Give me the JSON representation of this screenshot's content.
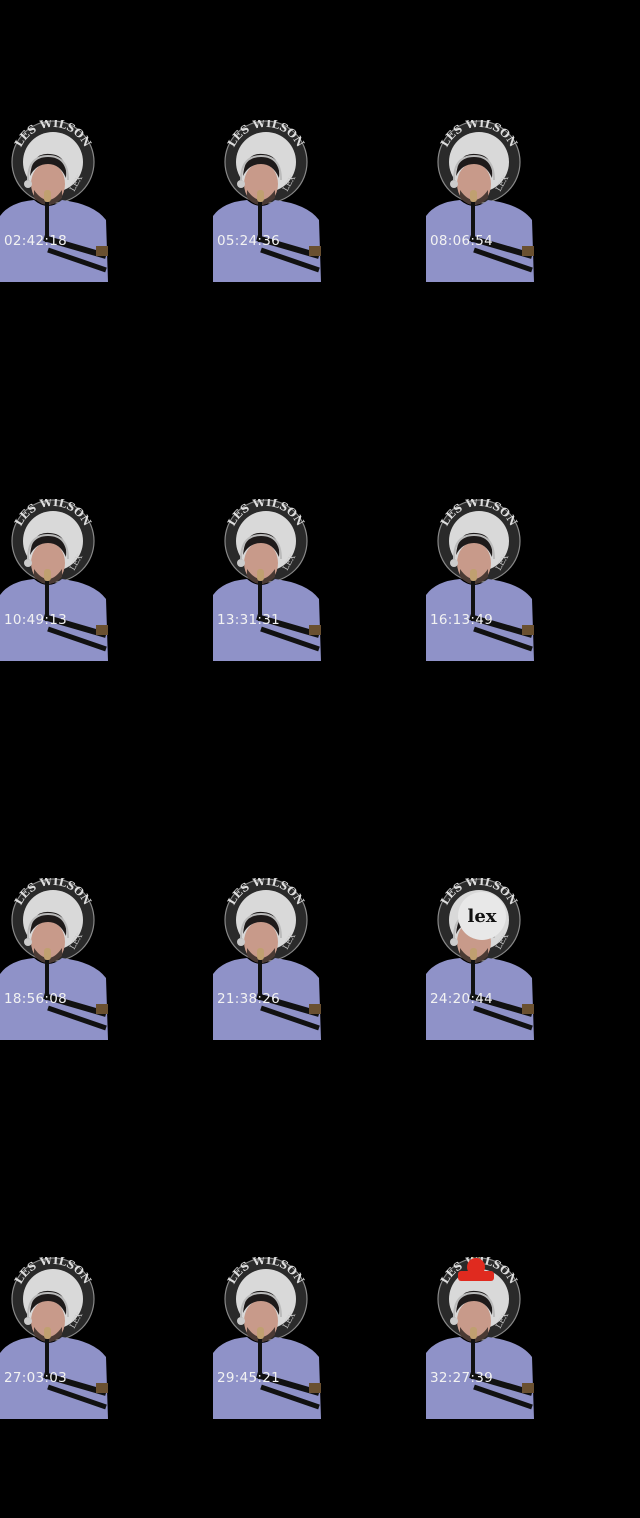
{
  "logo_text": {
    "top": "LES WILSON",
    "side": "LEX"
  },
  "frames": [
    {
      "time": "02:42:18",
      "variant": "a"
    },
    {
      "time": "05:24:36",
      "variant": "a"
    },
    {
      "time": "08:06:54",
      "variant": "a"
    },
    {
      "time": "10:49:13",
      "variant": "a"
    },
    {
      "time": "13:31:31",
      "variant": "a"
    },
    {
      "time": "16:13:49",
      "variant": "a"
    },
    {
      "time": "18:56:08",
      "variant": "a"
    },
    {
      "time": "21:38:26",
      "variant": "a"
    },
    {
      "time": "24:20:44",
      "variant": "b"
    },
    {
      "time": "27:03:03",
      "variant": "a"
    },
    {
      "time": "29:45:21",
      "variant": "a"
    },
    {
      "time": "32:27:39",
      "variant": "c"
    }
  ],
  "colors": {
    "background": "#000000",
    "timestamp": "#f2f2f2",
    "shirt": "#8f92c8",
    "badge": "#e02a1f"
  }
}
